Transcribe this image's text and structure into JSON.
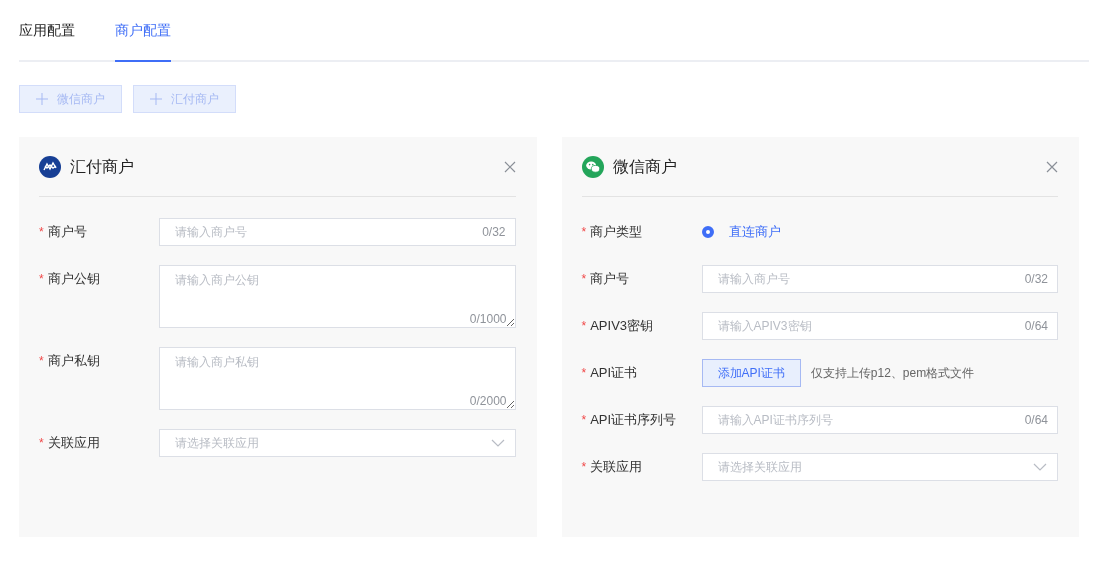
{
  "tabs": [
    {
      "label": "应用配置",
      "selected": false
    },
    {
      "label": "商户配置",
      "selected": true
    }
  ],
  "toolbar": [
    {
      "label": "微信商户",
      "disabled": true
    },
    {
      "label": "汇付商户",
      "disabled": true
    }
  ],
  "cards": [
    {
      "kind": "huifu",
      "title": "汇付商户",
      "fields": [
        {
          "kind": "input",
          "label": "商户号",
          "required_mark": "*",
          "placeholder": "请输入商户号",
          "counter": "0/32"
        },
        {
          "kind": "textarea",
          "label": "商户公钥",
          "required_mark": "*",
          "placeholder": "请输入商户公钥",
          "counter": "0/1000"
        },
        {
          "kind": "textarea",
          "label": "商户私钥",
          "required_mark": "*",
          "placeholder": "请输入商户私钥",
          "counter": "0/2000"
        },
        {
          "kind": "select",
          "label": "关联应用",
          "required_mark": "*",
          "placeholder": "请选择关联应用"
        }
      ]
    },
    {
      "kind": "wechat",
      "title": "微信商户",
      "fields": [
        {
          "kind": "radio",
          "label": "商户类型",
          "required_mark": "*",
          "options": [
            {
              "label": "直连商户",
              "selected": true
            }
          ]
        },
        {
          "kind": "input",
          "label": "商户号",
          "required_mark": "*",
          "placeholder": "请输入商户号",
          "counter": "0/32"
        },
        {
          "kind": "input",
          "label": "APIV3密钥",
          "required_mark": "*",
          "placeholder": "请输入APIV3密钥",
          "counter": "0/64"
        },
        {
          "kind": "upload",
          "label": "API证书",
          "required_mark": "*",
          "button": "添加API证书",
          "hint": "仅支持上传p12、pem格式文件"
        },
        {
          "kind": "input",
          "label": "API证书序列号",
          "required_mark": "*",
          "placeholder": "请输入API证书序列号",
          "counter": "0/64"
        },
        {
          "kind": "select",
          "label": "关联应用",
          "required_mark": "*",
          "placeholder": "请选择关联应用"
        }
      ]
    }
  ]
}
